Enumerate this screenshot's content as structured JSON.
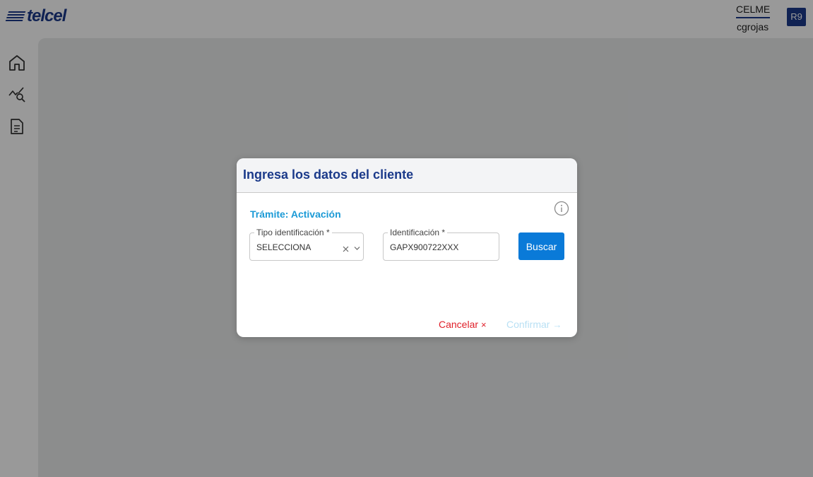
{
  "header": {
    "brand": "telcel",
    "company": "CELME",
    "username": "cgrojas",
    "region": "R9"
  },
  "sidebar": {
    "items": [
      {
        "icon": "home-icon"
      },
      {
        "icon": "chart-search-icon"
      },
      {
        "icon": "document-icon"
      }
    ]
  },
  "modal": {
    "title": "Ingresa los datos del cliente",
    "tramite": "Trámite: Activación",
    "type_field": {
      "label": "Tipo identificación *",
      "value": "SELECCIONA"
    },
    "id_field": {
      "label": "Identificación *",
      "value": "GAPX900722XXX"
    },
    "search_label": "Buscar",
    "cancel_label": "Cancelar",
    "cancel_icon": "×",
    "confirm_label": "Confirmar",
    "confirm_icon": "→"
  },
  "colors": {
    "brand": "#1b3a8a",
    "accent": "#0a7ad8",
    "tramite": "#1b9ad6",
    "danger": "#e0202a",
    "disabled": "#b9e0f4"
  }
}
